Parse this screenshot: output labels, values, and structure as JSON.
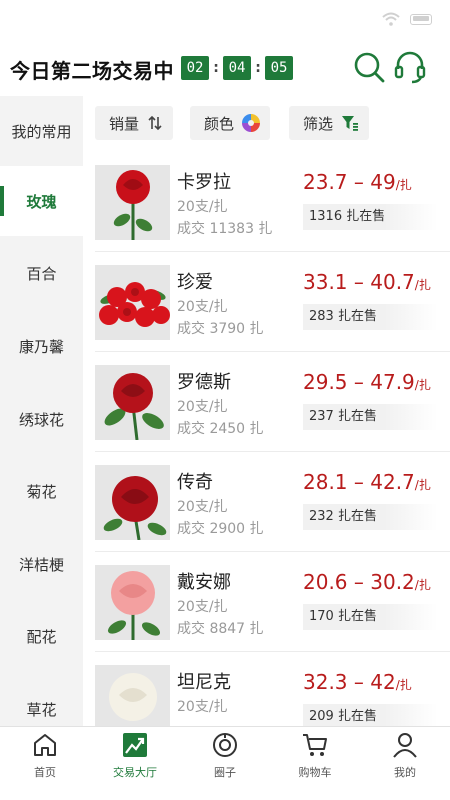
{
  "header": {
    "title": "今日第二场交易中",
    "timer": {
      "hours": "02",
      "minutes": "04",
      "seconds": "05",
      "sep": ":"
    },
    "search_icon": "search-icon",
    "service_icon": "headset-icon"
  },
  "sidebar": {
    "items": [
      {
        "label": "我的常用"
      },
      {
        "label": "玫瑰"
      },
      {
        "label": "百合"
      },
      {
        "label": "康乃馨"
      },
      {
        "label": "绣球花"
      },
      {
        "label": "菊花"
      },
      {
        "label": "洋桔梗"
      },
      {
        "label": "配花"
      },
      {
        "label": "草花"
      }
    ],
    "active_index": 1
  },
  "filters": {
    "sales": {
      "label": "销量",
      "icon": "sort-icon"
    },
    "color": {
      "label": "颜色",
      "icon": "color-wheel-icon"
    },
    "screen": {
      "label": "筛选",
      "icon": "filter-icon"
    }
  },
  "products": [
    {
      "name": "卡罗拉",
      "spec": "20支/扎",
      "deal": "成交 11383 扎",
      "price": "23.7 – 49",
      "unit": "/扎",
      "stock": "1316 扎在售",
      "flower_color": "#c8101a",
      "style": "single"
    },
    {
      "name": "珍爱",
      "spec": "20支/扎",
      "deal": "成交 3790 扎",
      "price": "33.1 – 40.7",
      "unit": "/扎",
      "stock": "283 扎在售",
      "flower_color": "#d8141c",
      "style": "bunch"
    },
    {
      "name": "罗德斯",
      "spec": "20支/扎",
      "deal": "成交 2450 扎",
      "price": "29.5 – 47.9",
      "unit": "/扎",
      "stock": "237 扎在售",
      "flower_color": "#b5121b",
      "style": "single"
    },
    {
      "name": "传奇",
      "spec": "20支/扎",
      "deal": "成交 2900 扎",
      "price": "28.1 – 42.7",
      "unit": "/扎",
      "stock": "232 扎在售",
      "flower_color": "#b0101a",
      "style": "single"
    },
    {
      "name": "戴安娜",
      "spec": "20支/扎",
      "deal": "成交 8847 扎",
      "price": "20.6 – 30.2",
      "unit": "/扎",
      "stock": "170 扎在售",
      "flower_color": "#f3a0a0",
      "style": "single"
    },
    {
      "name": "坦尼克",
      "spec": "20支/扎",
      "deal": "",
      "price": "32.3 – 42",
      "unit": "/扎",
      "stock": "209 扎在售",
      "flower_color": "#f4f1e6",
      "style": "single"
    }
  ],
  "tabbar": {
    "items": [
      {
        "label": "首页",
        "icon": "home-icon"
      },
      {
        "label": "交易大厅",
        "icon": "trading-hall-icon"
      },
      {
        "label": "圈子",
        "icon": "circle-icon"
      },
      {
        "label": "购物车",
        "icon": "cart-icon"
      },
      {
        "label": "我的",
        "icon": "profile-icon"
      }
    ],
    "active_index": 1
  },
  "colors": {
    "brand_green": "#1f7a3a",
    "price_red": "#b81c1c"
  }
}
